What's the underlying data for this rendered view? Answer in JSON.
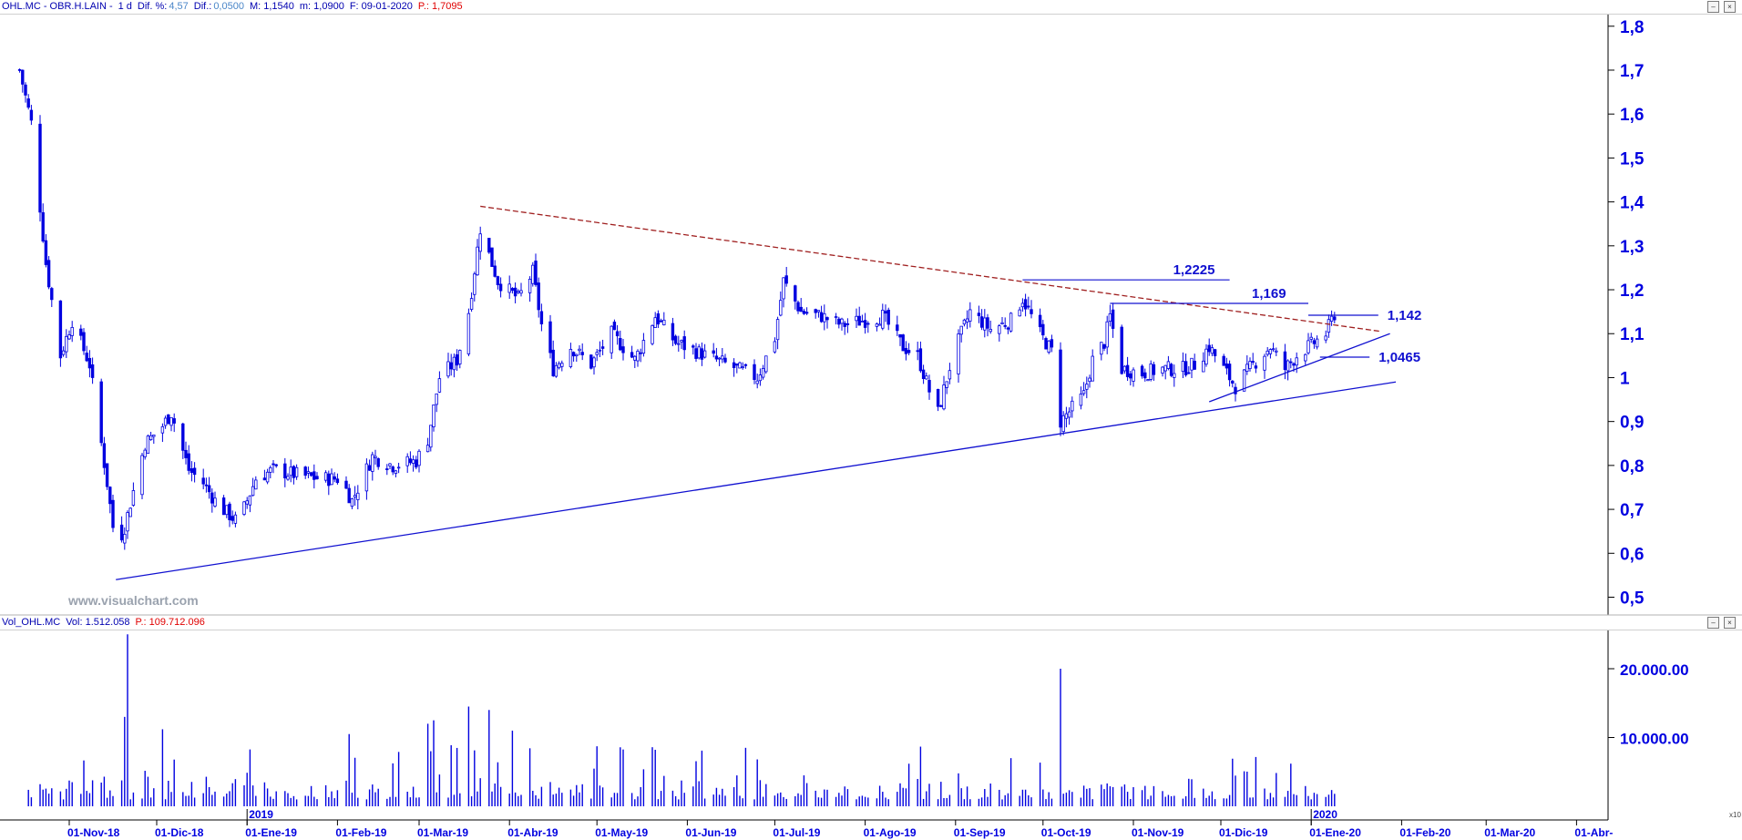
{
  "price_header": {
    "symbol": "OHL.MC - OBR.H.LAIN -",
    "interval": "1 d",
    "difpct_label": "Dif. %:",
    "difpct_value": "4,57",
    "dif_label": "Dif.:",
    "dif_value": "0,0500",
    "max_text": "M: 1,1540",
    "min_text": "m: 1,0900",
    "date_text": "F: 09-01-2020",
    "p_text": "P.: 1,7095"
  },
  "volume_header": {
    "name": "Vol_OHL.MC",
    "vol_text": "Vol: 1.512.058",
    "p_text": "P.: 109.712.096"
  },
  "watermark": "www.visualchart.com",
  "volume_axis_corner": "x10",
  "colors": {
    "candle": "#0000e0",
    "trend_main": "#1010d0",
    "trend_down": "#a02020",
    "hline": "#1010d0",
    "axis_text": "#0000e0",
    "volume": "#0000e0"
  },
  "chart_data": [
    {
      "type": "candlestick",
      "series_id": "OHL.MC",
      "interval": "1 d",
      "date_range": [
        "2018-10-15",
        "2020-01-09"
      ],
      "y_axis": {
        "min": 0.46,
        "max": 1.83,
        "ticks": [
          "1,8",
          "1,7",
          "1,6",
          "1,5",
          "1,4",
          "1,3",
          "1,2",
          "1,1",
          "1",
          "0,9",
          "0,8",
          "0,7",
          "0,6",
          "0,5"
        ]
      },
      "x_axis": {
        "tick_labels": [
          "01-Nov-18",
          "01-Dic-18",
          "01-Ene-19",
          "01-Feb-19",
          "01-Mar-19",
          "01-Abr-19",
          "01-May-19",
          "01-Jun-19",
          "01-Jul-19",
          "01-Ago-19",
          "01-Sep-19",
          "01-Oct-19",
          "01-Nov-19",
          "01-Dic-19",
          "01-Ene-20",
          "01-Feb-20",
          "01-Mar-20",
          "01-Abr-"
        ],
        "year_labels": [
          "2019",
          "2020"
        ]
      },
      "close_path": [
        [
          "2018-10-15",
          1.7
        ],
        [
          "2018-10-19",
          1.58
        ],
        [
          "2018-10-24",
          1.26
        ],
        [
          "2018-10-29",
          1.05
        ],
        [
          "2018-11-02",
          1.13
        ],
        [
          "2018-11-08",
          1.03
        ],
        [
          "2018-11-14",
          0.76
        ],
        [
          "2018-11-17",
          0.61
        ],
        [
          "2018-11-20",
          0.66
        ],
        [
          "2018-11-27",
          0.85
        ],
        [
          "2018-12-03",
          0.89
        ],
        [
          "2018-12-06",
          0.92
        ],
        [
          "2018-12-12",
          0.79
        ],
        [
          "2018-12-17",
          0.76
        ],
        [
          "2018-12-22",
          0.71
        ],
        [
          "2018-12-29",
          0.67
        ],
        [
          "2019-01-04",
          0.77
        ],
        [
          "2019-01-10",
          0.79
        ],
        [
          "2019-01-17",
          0.78
        ],
        [
          "2019-01-26",
          0.77
        ],
        [
          "2019-02-02",
          0.77
        ],
        [
          "2019-02-06",
          0.72
        ],
        [
          "2019-02-13",
          0.82
        ],
        [
          "2019-02-20",
          0.8
        ],
        [
          "2019-02-28",
          0.81
        ],
        [
          "2019-03-04",
          0.86
        ],
        [
          "2019-03-08",
          1.0
        ],
        [
          "2019-03-14",
          1.04
        ],
        [
          "2019-03-18",
          1.15
        ],
        [
          "2019-03-22",
          1.34
        ],
        [
          "2019-03-28",
          1.22
        ],
        [
          "2019-04-04",
          1.18
        ],
        [
          "2019-04-09",
          1.24
        ],
        [
          "2019-04-12",
          1.12
        ],
        [
          "2019-04-16",
          1.02
        ],
        [
          "2019-04-22",
          1.07
        ],
        [
          "2019-04-29",
          1.03
        ],
        [
          "2019-05-06",
          1.1
        ],
        [
          "2019-05-14",
          1.04
        ],
        [
          "2019-05-21",
          1.14
        ],
        [
          "2019-05-28",
          1.08
        ],
        [
          "2019-06-04",
          1.06
        ],
        [
          "2019-06-11",
          1.04
        ],
        [
          "2019-06-18",
          1.02
        ],
        [
          "2019-06-25",
          1.0
        ],
        [
          "2019-07-01",
          1.09
        ],
        [
          "2019-07-04",
          1.22
        ],
        [
          "2019-07-10",
          1.15
        ],
        [
          "2019-07-17",
          1.14
        ],
        [
          "2019-07-24",
          1.12
        ],
        [
          "2019-07-31",
          1.13
        ],
        [
          "2019-08-07",
          1.14
        ],
        [
          "2019-08-14",
          1.07
        ],
        [
          "2019-08-19",
          1.05
        ],
        [
          "2019-08-23",
          0.97
        ],
        [
          "2019-08-26",
          0.92
        ],
        [
          "2019-08-31",
          1.05
        ],
        [
          "2019-09-06",
          1.15
        ],
        [
          "2019-09-13",
          1.11
        ],
        [
          "2019-09-20",
          1.13
        ],
        [
          "2019-09-24",
          1.18
        ],
        [
          "2019-09-30",
          1.1
        ],
        [
          "2019-10-04",
          1.06
        ],
        [
          "2019-10-07",
          0.9
        ],
        [
          "2019-10-11",
          0.93
        ],
        [
          "2019-10-15",
          0.96
        ],
        [
          "2019-10-18",
          1.04
        ],
        [
          "2019-10-22",
          1.08
        ],
        [
          "2019-10-24",
          1.14
        ],
        [
          "2019-10-28",
          1.02
        ],
        [
          "2019-11-04",
          1.01
        ],
        [
          "2019-11-11",
          1.02
        ],
        [
          "2019-11-18",
          1.02
        ],
        [
          "2019-11-22",
          1.03
        ],
        [
          "2019-11-27",
          1.07
        ],
        [
          "2019-12-02",
          1.02
        ],
        [
          "2019-12-06",
          0.98
        ],
        [
          "2019-12-12",
          1.03
        ],
        [
          "2019-12-18",
          1.07
        ],
        [
          "2019-12-23",
          1.02
        ],
        [
          "2019-12-27",
          1.05
        ],
        [
          "2020-01-02",
          1.08
        ],
        [
          "2020-01-06",
          1.1
        ],
        [
          "2020-01-09",
          1.145
        ]
      ],
      "annotations": [
        {
          "type": "trendline",
          "name": "support",
          "style": "solid",
          "from": [
            "2018-11-17",
            0.54
          ],
          "to": [
            "2020-01-30",
            0.99
          ]
        },
        {
          "type": "trendline",
          "name": "resistance",
          "style": "dashed",
          "from": [
            "2019-03-22",
            1.39
          ],
          "to": [
            "2020-01-25",
            1.105
          ]
        },
        {
          "type": "trendline",
          "name": "short-term support",
          "style": "solid",
          "from": [
            "2019-11-27",
            0.945
          ],
          "to": [
            "2020-01-28",
            1.1
          ]
        },
        {
          "type": "hline",
          "label": "1,2225",
          "value": 1.2225,
          "from": "2019-09-24",
          "to": "2019-12-04"
        },
        {
          "type": "hline",
          "label": "1,169",
          "value": 1.169,
          "from": "2019-10-24",
          "to": "2019-12-31"
        },
        {
          "type": "hline",
          "label": "1,142",
          "value": 1.142,
          "from": "2019-12-31",
          "to": "2020-01-24"
        },
        {
          "type": "hline",
          "label": "1,0465",
          "value": 1.0465,
          "from": "2020-01-04",
          "to": "2020-01-21"
        }
      ]
    },
    {
      "type": "bar",
      "series_id": "Vol_OHL.MC",
      "y_axis": {
        "min": 0,
        "max": 27000,
        "ticks": [
          "20.000.00",
          "10.000.00"
        ],
        "tick_values": [
          20000,
          10000
        ]
      },
      "peaks": [
        [
          "2018-11-21",
          25000
        ],
        [
          "2018-11-20",
          13000
        ],
        [
          "2018-11-24",
          12000
        ],
        [
          "2018-12-03",
          11200
        ],
        [
          "2019-02-05",
          10500
        ],
        [
          "2019-03-04",
          12000
        ],
        [
          "2019-03-06",
          12500
        ],
        [
          "2019-03-18",
          14500
        ],
        [
          "2019-03-25",
          14000
        ],
        [
          "2019-04-02",
          11000
        ],
        [
          "2019-10-07",
          20000
        ],
        [
          "2019-09-20",
          7000
        ],
        [
          "2019-12-25",
          6200
        ]
      ],
      "typical_range": [
        1000,
        6000
      ]
    }
  ]
}
